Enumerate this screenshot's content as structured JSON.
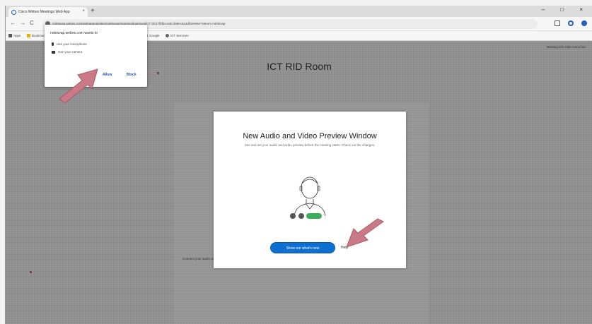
{
  "browser": {
    "tab_title": "Cisco Webex Meetings Web App",
    "tab_close": "×",
    "new_tab": "+",
    "window_controls": "–  □  ×",
    "back": "←",
    "forward": "→",
    "reload": "C",
    "url": "nobtsvap.webex.com/webappng/sites/nobtsvap/meeting/download/0772b17f8fbe1a8c4b8ec6a4df0e0e6e?siteurl=nobtsvap",
    "toolbar_icons": [
      "extensions-icon",
      "account-icon",
      "menu-icon"
    ],
    "accent": "#1f5fbf"
  },
  "bookmarks": {
    "items": [
      {
        "label": "Apps"
      },
      {
        "label": "Bookmarks"
      },
      {
        "label": "Google"
      },
      {
        "label": "ICT Services"
      }
    ]
  },
  "page": {
    "room_title": "ICT RID Room",
    "meeting_info": "Meeting info    Hide menu bar",
    "background_text": "Connect your audio and video to join the meeting, then select Join Meeting when you're ready."
  },
  "modal": {
    "title": "New Audio and Video Preview Window",
    "description": "See and set your audio and video preview before the meeting starts. Check out the changes.",
    "show_button": "Show me what's new",
    "help_link": "Help",
    "button_color": "#0e6fd1"
  },
  "permission_popup": {
    "title": "nobtsvap.webex.com wants to",
    "rows": [
      {
        "label": "Use your microphone",
        "icon": "microphone-icon"
      },
      {
        "label": "Use your camera",
        "icon": "camera-icon"
      }
    ],
    "allow": "Allow",
    "block": "Block"
  },
  "annotations": {
    "arrow_color": "#c97a86"
  }
}
